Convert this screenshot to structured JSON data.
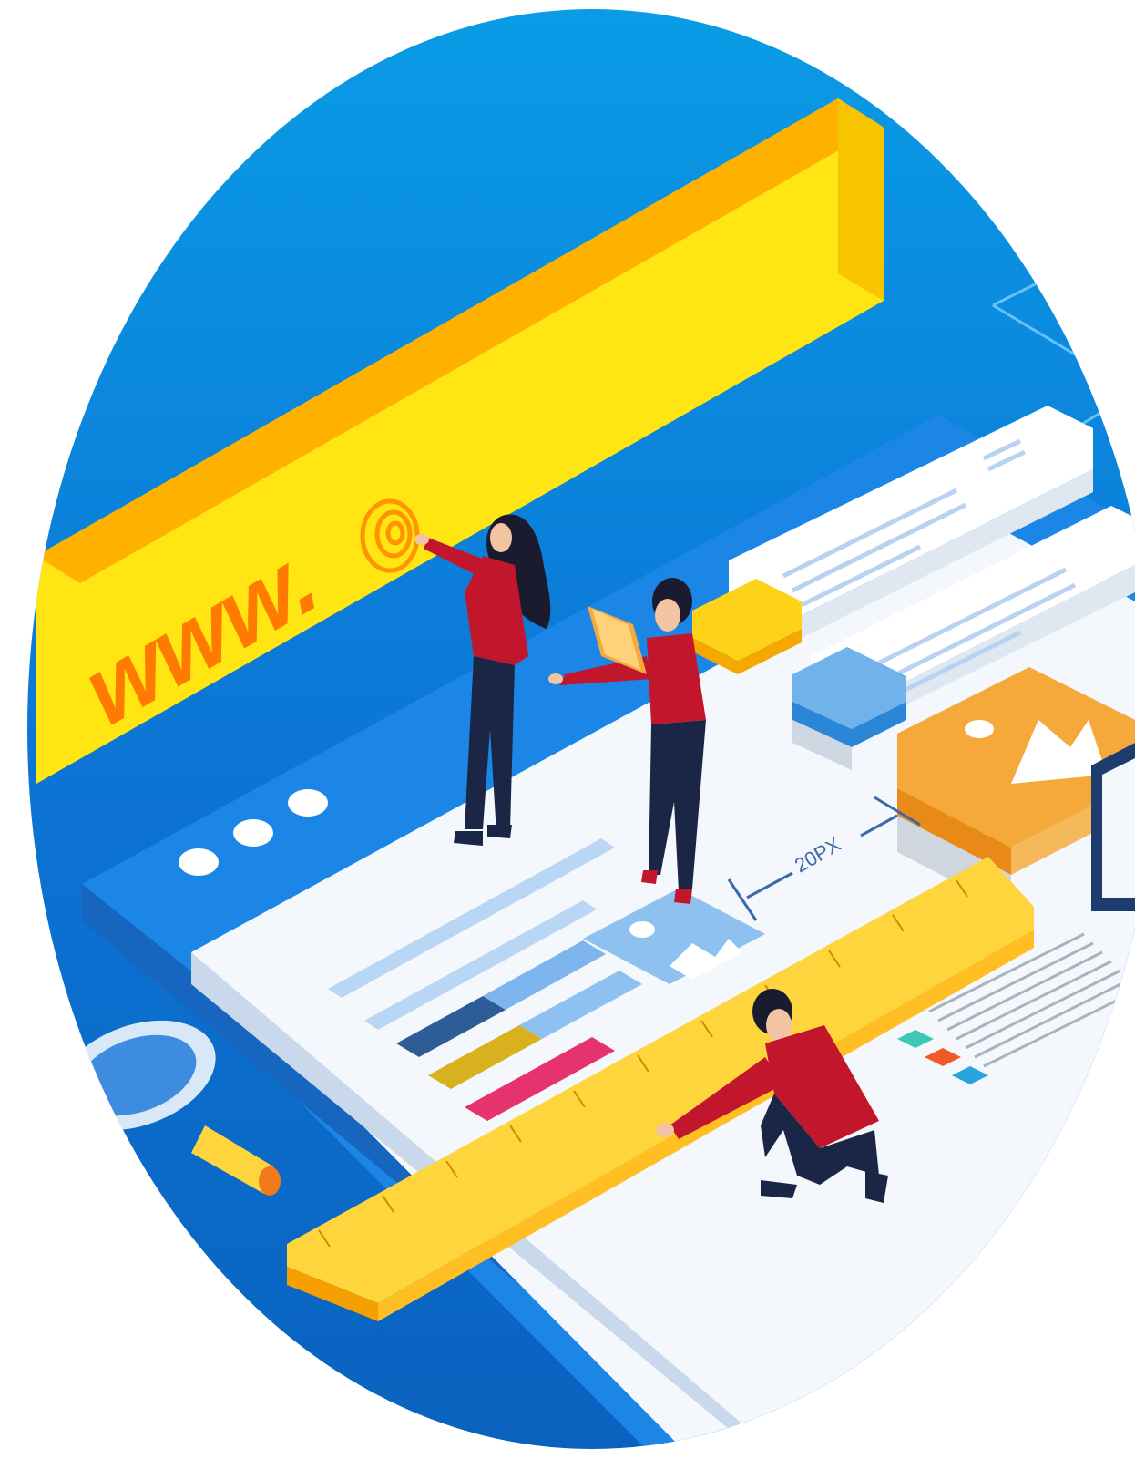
{
  "address_bar": {
    "url_prefix": "www.",
    "icon": "at-sign-icon"
  },
  "measurement": {
    "label": "20PX"
  },
  "window_controls": {
    "dot_count": 3,
    "icons": [
      "window-dot-icon",
      "window-dot-icon",
      "window-dot-icon"
    ]
  },
  "colors": {
    "background_blue": "#0c73d4",
    "background_blue_light": "#0a9ce6",
    "address_bar_yellow": "#ffe511",
    "address_bar_orange": "#ffb100",
    "url_text_orange": "#ff7a00",
    "browser_window_blue": "#1e90f0",
    "canvas_white": "#f4f7fb",
    "ruler_yellow": "#ffd53d",
    "shirt_red": "#c2162c",
    "pants_navy": "#1b2647",
    "image_card_orange": "#f6a93b",
    "bar_pink": "#e6336e",
    "bar_gold": "#d8b21e",
    "bar_navy": "#2d5c96"
  },
  "figures": [
    "woman-pointing",
    "woman-with-tablet",
    "man-with-ruler"
  ],
  "objects": [
    "magnifier-icon",
    "image-placeholder-icon",
    "ruler",
    "text-line-blocks",
    "color-swatches"
  ]
}
